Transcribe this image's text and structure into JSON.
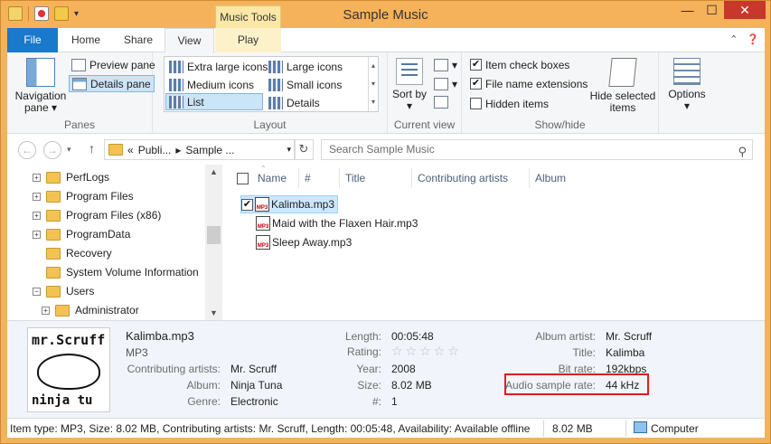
{
  "window": {
    "title": "Sample Music",
    "context_tab": "Music Tools",
    "controls": {
      "minimize": "—",
      "maximize": "☐",
      "close": "✕"
    }
  },
  "ribbon_tabs": [
    {
      "label": "File"
    },
    {
      "label": "Home"
    },
    {
      "label": "Share"
    },
    {
      "label": "View"
    },
    {
      "label": "Play"
    }
  ],
  "ribbon": {
    "panes": {
      "label": "Panes",
      "navigation_pane": "Navigation pane",
      "preview_pane": "Preview pane",
      "details_pane": "Details pane"
    },
    "layout": {
      "label": "Layout",
      "items": [
        {
          "label": "Extra large icons"
        },
        {
          "label": "Large icons"
        },
        {
          "label": "Medium icons"
        },
        {
          "label": "Small icons"
        },
        {
          "label": "List"
        },
        {
          "label": "Details"
        }
      ]
    },
    "current_view": {
      "label": "Current view",
      "sort_by": "Sort by"
    },
    "show_hide": {
      "label": "Show/hide",
      "item_check_boxes": "Item check boxes",
      "file_name_extensions": "File name extensions",
      "hidden_items": "Hidden items",
      "hide_selected_items": "Hide selected items"
    },
    "options": {
      "label": "Options"
    }
  },
  "address": {
    "breadcrumb_prefix": "«",
    "segments": [
      "Publi...",
      "Sample ..."
    ],
    "search_placeholder": "Search Sample Music"
  },
  "nav_tree": [
    {
      "label": "PerfLogs",
      "expander": "+"
    },
    {
      "label": "Program Files",
      "expander": "+"
    },
    {
      "label": "Program Files (x86)",
      "expander": "+"
    },
    {
      "label": "ProgramData",
      "expander": "+"
    },
    {
      "label": "Recovery",
      "expander": ""
    },
    {
      "label": "System Volume Information",
      "expander": ""
    },
    {
      "label": "Users",
      "expander": "−"
    },
    {
      "label": "Administrator",
      "expander": "+"
    }
  ],
  "columns": [
    "Name",
    "#",
    "Title",
    "Contributing artists",
    "Album"
  ],
  "files": [
    {
      "name": "Kalimba.mp3",
      "selected": true
    },
    {
      "name": "Maid with the Flaxen Hair.mp3",
      "selected": false
    },
    {
      "name": "Sleep Away.mp3",
      "selected": false
    }
  ],
  "details": {
    "file_name": "Kalimba.mp3",
    "file_type": "MP3",
    "thumbnail_text_top": "mr.Scruff",
    "thumbnail_text_bottom": "ninja tu",
    "props_left": [
      {
        "label": "Contributing artists:",
        "value": "Mr. Scruff"
      },
      {
        "label": "Album:",
        "value": "Ninja Tuna"
      },
      {
        "label": "Genre:",
        "value": "Electronic"
      }
    ],
    "props_mid": [
      {
        "label": "Length:",
        "value": "00:05:48"
      },
      {
        "label": "Rating:",
        "value": "☆☆☆☆☆"
      },
      {
        "label": "Year:",
        "value": "2008"
      },
      {
        "label": "Size:",
        "value": "8.02 MB"
      },
      {
        "label": "#:",
        "value": "1"
      }
    ],
    "props_right": [
      {
        "label": "Album artist:",
        "value": "Mr. Scruff"
      },
      {
        "label": "Title:",
        "value": "Kalimba"
      },
      {
        "label": "Bit rate:",
        "value": "192kbps"
      },
      {
        "label": "Audio sample rate:",
        "value": "44 kHz"
      }
    ]
  },
  "statusbar": {
    "info": "Item type: MP3, Size: 8.02 MB, Contributing artists: Mr. Scruff, Length: 00:05:48, Availability: Available offline",
    "size": "8.02 MB",
    "location": "Computer"
  },
  "colors": {
    "accent": "#1979ca",
    "title_bar": "#f6b25a",
    "highlight_box": "#e01d1d"
  }
}
